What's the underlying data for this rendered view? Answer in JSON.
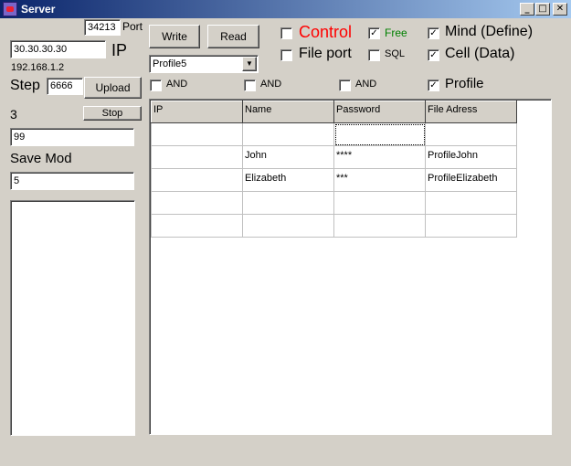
{
  "window": {
    "title": "Server",
    "minimize": "_",
    "maximize": "□",
    "close": "✕"
  },
  "left": {
    "port_value": "34213",
    "port_label": "Port",
    "ip_value": "30.30.30.30",
    "ip_label": "IP",
    "local_ip": "192.168.1.2",
    "step_label": "Step",
    "step_value": "6666",
    "upload_label": "Upload",
    "counter": "3",
    "stop_label": "Stop",
    "field_value": "99",
    "save_mod_label": "Save Mod",
    "save_mod_value": "5"
  },
  "toolbar": {
    "write_label": "Write",
    "read_label": "Read",
    "profile_select": "Profile5"
  },
  "options": {
    "control": {
      "label": "Control",
      "checked": false,
      "color": "#ff0000"
    },
    "file_port": {
      "label": "File port",
      "checked": false
    },
    "free": {
      "label": "Free",
      "checked": true,
      "color": "#008000"
    },
    "sql": {
      "label": "SQL",
      "checked": false
    },
    "mind": {
      "label": "Mind (Define)",
      "checked": true
    },
    "cell": {
      "label": "Cell (Data)",
      "checked": true
    },
    "and1": {
      "label": "AND",
      "checked": false
    },
    "and2": {
      "label": "AND",
      "checked": false
    },
    "and3": {
      "label": "AND",
      "checked": false
    },
    "profile": {
      "label": "Profile",
      "checked": true
    }
  },
  "grid": {
    "columns": [
      "IP",
      "Name",
      "Password",
      "File Adress"
    ],
    "rows": [
      [
        "",
        "",
        "",
        ""
      ],
      [
        "",
        "John",
        "****",
        "ProfileJohn"
      ],
      [
        "",
        "Elizabeth",
        "***",
        "ProfileElizabeth"
      ],
      [
        "",
        "",
        "",
        ""
      ],
      [
        "",
        "",
        "",
        ""
      ]
    ]
  }
}
